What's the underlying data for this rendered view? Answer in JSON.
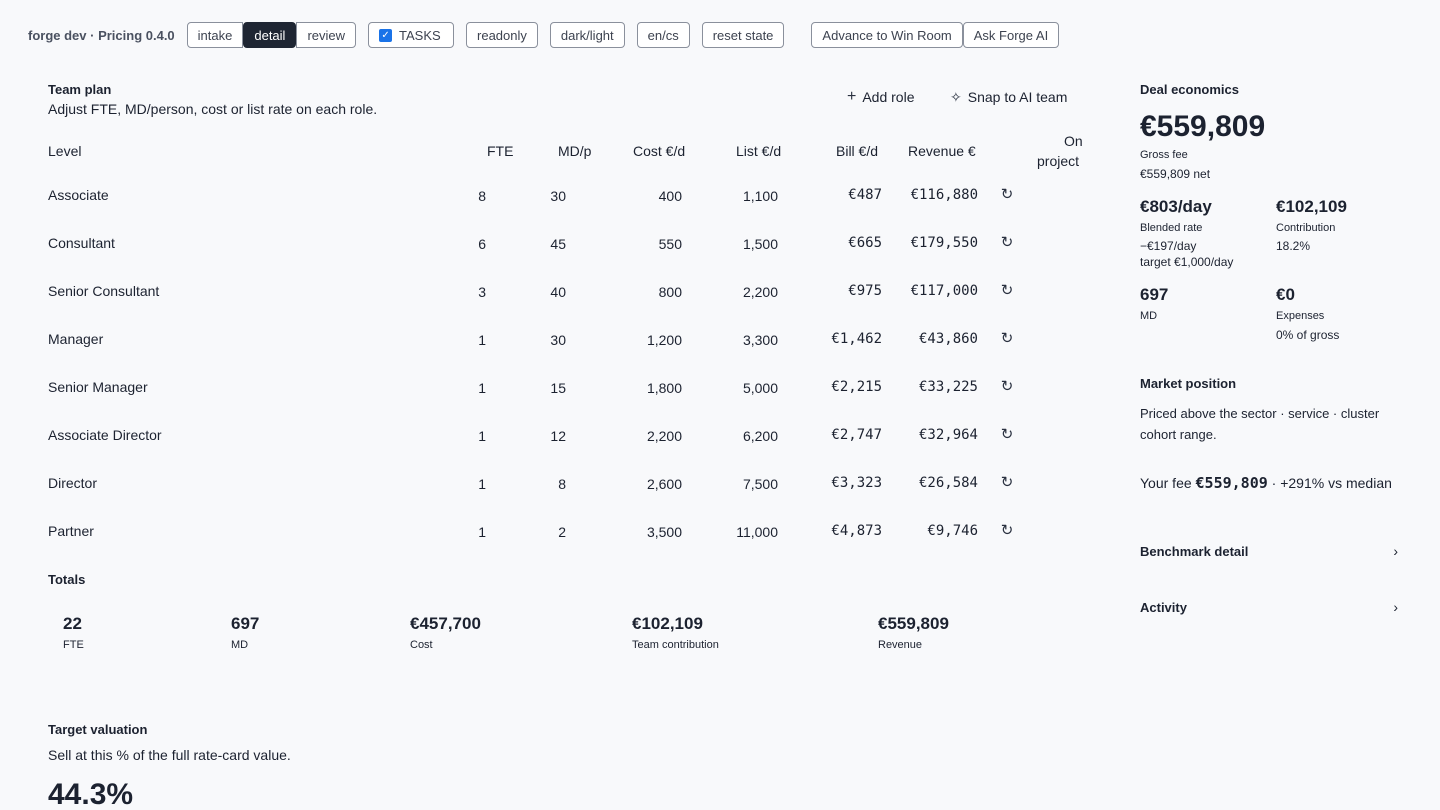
{
  "app": {
    "title": "forge dev · Pricing 0.4.0"
  },
  "toolbar": {
    "tabs": [
      "intake",
      "detail",
      "review"
    ],
    "tasks_label": "TASKS",
    "buttons": [
      "readonly",
      "dark/light",
      "en/cs",
      "reset state"
    ],
    "advance_label": "Advance to Win Room",
    "ask_ai_label": "Ask Forge AI"
  },
  "team_plan": {
    "title": "Team plan",
    "subtitle": "Adjust FTE, MD/person, cost or list rate on each role.",
    "add_role": "Add role",
    "snap": "Snap to AI team",
    "columns": {
      "level": "Level",
      "fte": "FTE",
      "mdp": "MD/p",
      "cost": "Cost €/d",
      "list": "List €/d",
      "bill": "Bill €/d",
      "revenue": "Revenue €",
      "on1": "On",
      "on2": "project"
    },
    "rows": [
      {
        "level": "Associate",
        "fte": "8",
        "mdp": "30",
        "cost": "400",
        "list": "1,100",
        "bill": "€487",
        "revenue": "€116,880"
      },
      {
        "level": "Consultant",
        "fte": "6",
        "mdp": "45",
        "cost": "550",
        "list": "1,500",
        "bill": "€665",
        "revenue": "€179,550"
      },
      {
        "level": "Senior Consultant",
        "fte": "3",
        "mdp": "40",
        "cost": "800",
        "list": "2,200",
        "bill": "€975",
        "revenue": "€117,000"
      },
      {
        "level": "Manager",
        "fte": "1",
        "mdp": "30",
        "cost": "1,200",
        "list": "3,300",
        "bill": "€1,462",
        "revenue": "€43,860"
      },
      {
        "level": "Senior Manager",
        "fte": "1",
        "mdp": "15",
        "cost": "1,800",
        "list": "5,000",
        "bill": "€2,215",
        "revenue": "€33,225"
      },
      {
        "level": "Associate Director",
        "fte": "1",
        "mdp": "12",
        "cost": "2,200",
        "list": "6,200",
        "bill": "€2,747",
        "revenue": "€32,964"
      },
      {
        "level": "Director",
        "fte": "1",
        "mdp": "8",
        "cost": "2,600",
        "list": "7,500",
        "bill": "€3,323",
        "revenue": "€26,584"
      },
      {
        "level": "Partner",
        "fte": "1",
        "mdp": "2",
        "cost": "3,500",
        "list": "11,000",
        "bill": "€4,873",
        "revenue": "€9,746"
      }
    ],
    "totals": {
      "title": "Totals",
      "items": [
        {
          "value": "22",
          "label": "FTE"
        },
        {
          "value": "697",
          "label": "MD"
        },
        {
          "value": "€457,700",
          "label": "Cost"
        },
        {
          "value": "€102,109",
          "label": "Team contribution"
        },
        {
          "value": "€559,809",
          "label": "Revenue"
        }
      ]
    }
  },
  "target_valuation": {
    "title": "Target valuation",
    "subtitle": "Sell at this % of the full rate-card value.",
    "value": "44.3%"
  },
  "deal_economics": {
    "title": "Deal economics",
    "total": "€559,809",
    "gross_label": "Gross fee",
    "net": "€559,809 net",
    "blended": {
      "value": "€803/day",
      "label": "Blended rate",
      "delta": "−€197/day",
      "target": "target €1,000/day"
    },
    "contribution": {
      "value": "€102,109",
      "label": "Contribution",
      "pct": "18.2%"
    },
    "md": {
      "value": "697",
      "label": "MD"
    },
    "expenses": {
      "value": "€0",
      "label": "Expenses",
      "pct": "0% of gross"
    }
  },
  "market_position": {
    "title": "Market position",
    "text": "Priced above the sector · service · cluster cohort range.",
    "fee_prefix": "Your fee ",
    "fee_value": "€559,809",
    "fee_suffix": " · +291% vs median"
  },
  "links": {
    "benchmark": "Benchmark detail",
    "activity": "Activity"
  },
  "icons": {
    "plus": "plus-icon",
    "sparkle": "sparkle-icon",
    "reset": "reset-icon",
    "chevron": "chevron-right-icon",
    "check": "check-icon"
  },
  "colors": {
    "text": "#1c2230",
    "active_tab": "#1f2633",
    "checkbox": "#1a73e8",
    "background": "#f8f9fb"
  }
}
